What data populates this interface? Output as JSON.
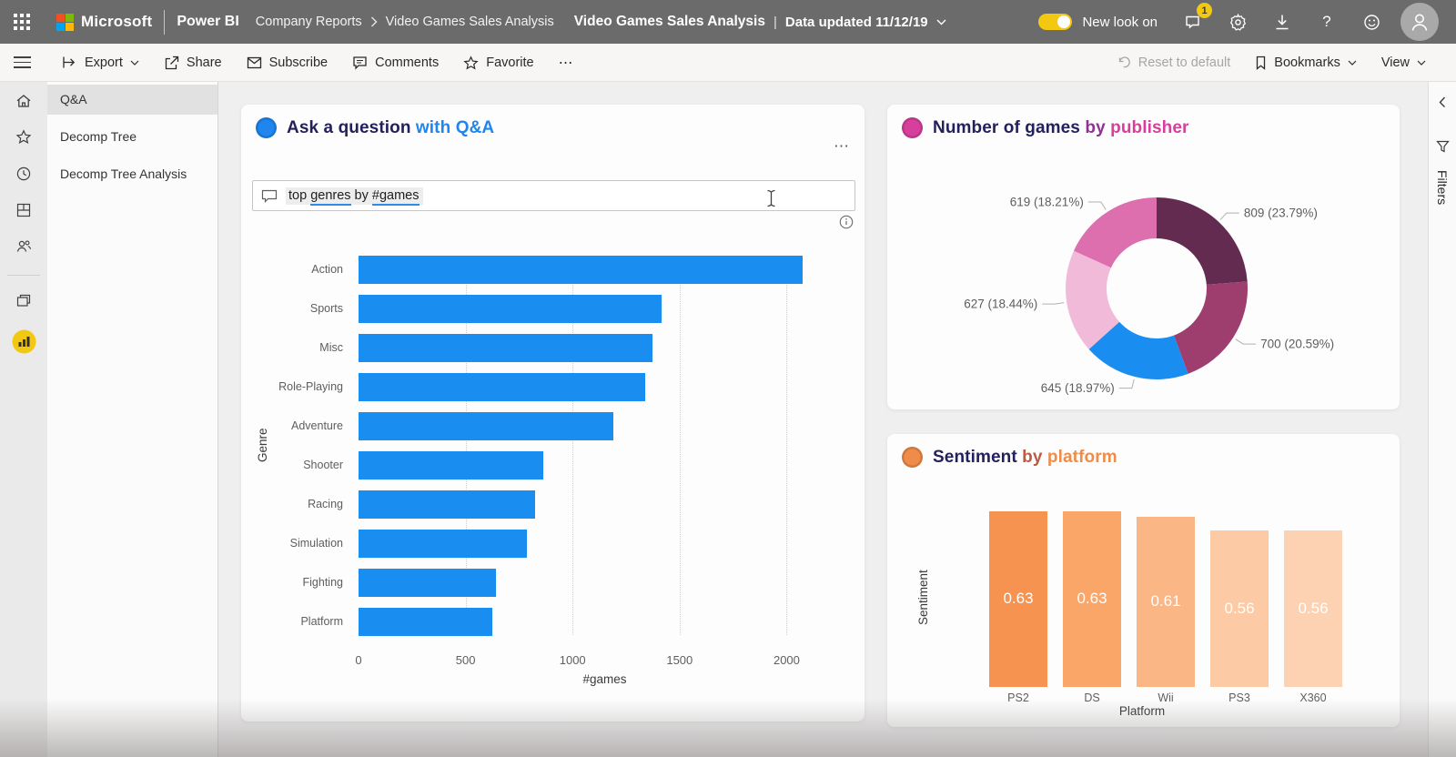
{
  "topbar": {
    "ms_label": "Microsoft",
    "product": "Power BI",
    "breadcrumb": {
      "parent": "Company Reports",
      "child": "Video Games Sales Analysis"
    },
    "title": "Video Games Sales Analysis",
    "separator": "|",
    "updated": "Data updated 11/12/19",
    "new_look": "New look on",
    "badge": "1",
    "help": "?"
  },
  "toolbar": {
    "export": "Export",
    "share": "Share",
    "subscribe": "Subscribe",
    "comments": "Comments",
    "favorite": "Favorite",
    "more": "⋯",
    "reset": "Reset to default",
    "bookmarks": "Bookmarks",
    "view": "View"
  },
  "sidebar": {
    "items": [
      {
        "label": "Q&A",
        "selected": true
      },
      {
        "label": "Decomp Tree",
        "selected": false
      },
      {
        "label": "Decomp Tree Analysis",
        "selected": false
      }
    ]
  },
  "filters": {
    "label": "Filters"
  },
  "cards": {
    "qa": {
      "title_segments": [
        {
          "text": "Ask a question ",
          "color": "#23215B"
        },
        {
          "text": "with Q&A",
          "color": "#1F86F0"
        }
      ],
      "icon_color": "#1F86F0",
      "more": "⋯",
      "query_tokens": [
        {
          "text": "top ",
          "underline": false
        },
        {
          "text": "genres",
          "underline": true
        },
        {
          "text": " by ",
          "underline": false
        },
        {
          "text": "#games",
          "underline": true
        }
      ]
    },
    "publisher": {
      "title_segments": [
        {
          "text": "Number of games ",
          "color": "#23215B"
        },
        {
          "text": "by ",
          "color": "#8F3390"
        },
        {
          "text": "publisher",
          "color": "#D6409C"
        }
      ],
      "icon_color": "#D6409C"
    },
    "sentiment": {
      "title_segments": [
        {
          "text": "Sentiment ",
          "color": "#23215B"
        },
        {
          "text": "by ",
          "color": "#BA5B45"
        },
        {
          "text": "platform",
          "color": "#EF8C49"
        }
      ],
      "icon_color": "#EF8C49"
    }
  },
  "chart_data": [
    {
      "type": "bar",
      "orientation": "horizontal",
      "title": "top genres by #games",
      "categories": [
        "Action",
        "Sports",
        "Misc",
        "Role-Playing",
        "Adventure",
        "Shooter",
        "Racing",
        "Simulation",
        "Fighting",
        "Platform"
      ],
      "values": [
        2075,
        1415,
        1375,
        1340,
        1190,
        865,
        825,
        785,
        640,
        625
      ],
      "xlabel": "#games",
      "ylabel": "Genre",
      "xlim": [
        0,
        2300
      ],
      "xticks": [
        0,
        500,
        1000,
        1500,
        2000
      ],
      "grid": true,
      "bar_color": "#1A8DF0"
    },
    {
      "type": "pie",
      "subtype": "donut",
      "title": "Number of games by publisher",
      "values": [
        809,
        700,
        645,
        627,
        619
      ],
      "labels": [
        "809 (23.79%)",
        "700 (20.59%)",
        "645 (18.97%)",
        "627 (18.44%)",
        "619 (18.21%)"
      ],
      "colors": [
        "#632B4F",
        "#9D3E6F",
        "#1A8DF0",
        "#F1BAD8",
        "#DE6FAF"
      ],
      "donut_hole_ratio": 0.55,
      "legend": "none"
    },
    {
      "type": "bar",
      "orientation": "vertical",
      "title": "Sentiment by platform",
      "categories": [
        "PS2",
        "DS",
        "Wii",
        "PS3",
        "X360"
      ],
      "values": [
        0.63,
        0.63,
        0.61,
        0.56,
        0.56
      ],
      "value_labels": [
        "0.63",
        "0.63",
        "0.61",
        "0.56",
        "0.56"
      ],
      "colors": [
        "#F79350",
        "#F9A668",
        "#FBB685",
        "#FCCBA5",
        "#FDD2B2"
      ],
      "xlabel": "Platform",
      "ylabel": "Sentiment",
      "ylim": [
        0,
        0.7
      ]
    }
  ]
}
